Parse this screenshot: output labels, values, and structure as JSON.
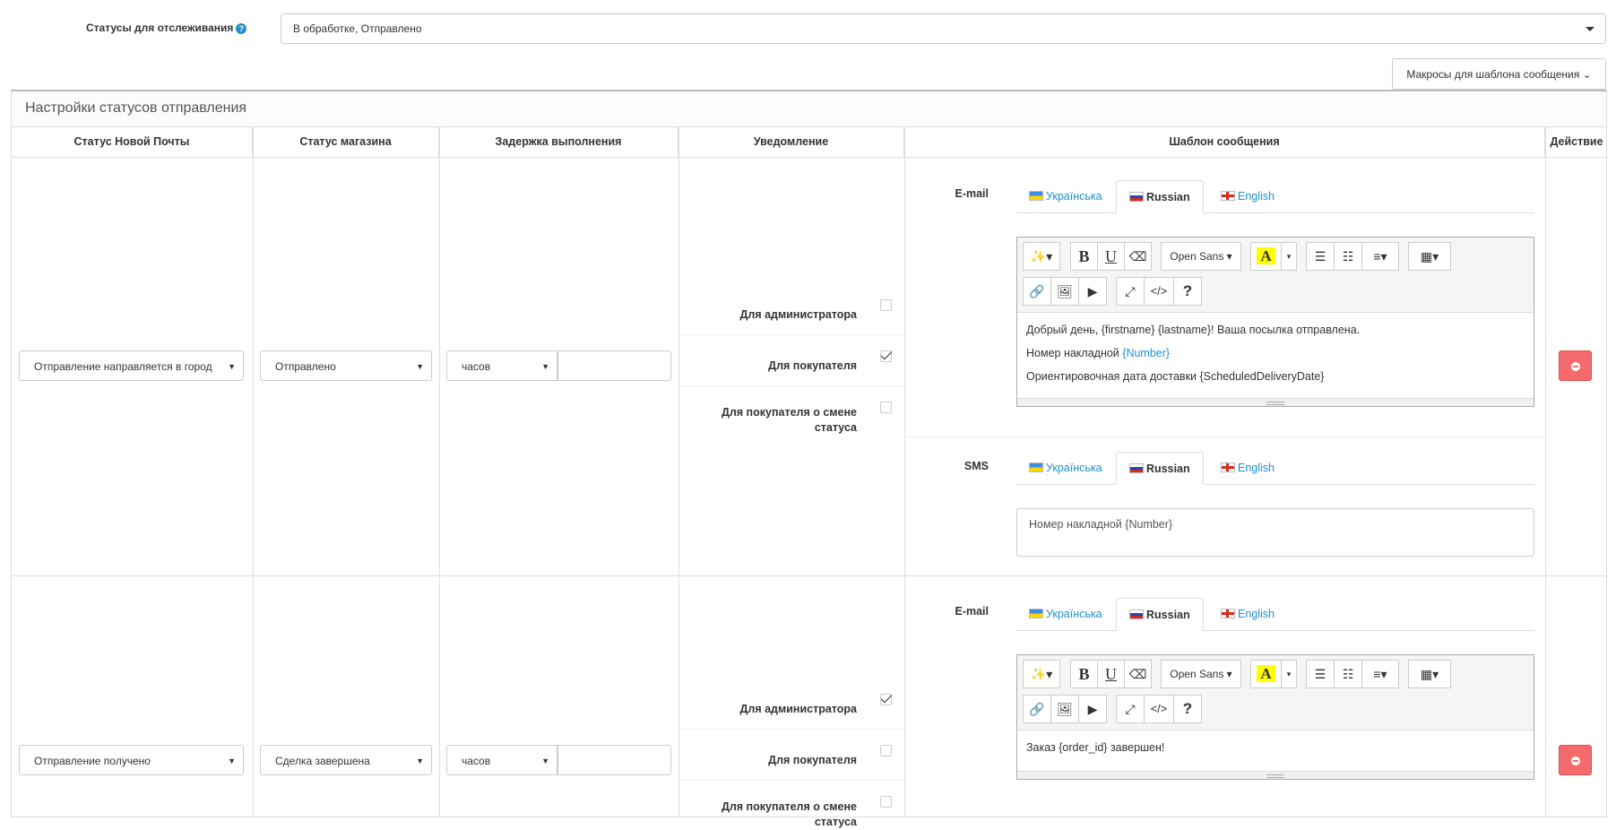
{
  "tracking": {
    "label": "Статусы для отслеживания",
    "value": "В обработке, Отправлено"
  },
  "macros_button": "Макросы для шаблона сообщения",
  "panel_title": "Настройки статусов отправления",
  "columns": [
    "Статус Новой Почты",
    "Статус магазина",
    "Задержка выполнения",
    "Уведомление",
    "Шаблон сообщения",
    "Действие"
  ],
  "languages": [
    "Українська",
    "Russian",
    "English"
  ],
  "channels": {
    "email": "E-mail",
    "sms": "SMS"
  },
  "toolbar": {
    "font": "Open Sans",
    "highlight": "A",
    "bold": "B",
    "underline": "U",
    "code": "</>",
    "help": "?"
  },
  "notifications": {
    "admin": "Для администратора",
    "buyer": "Для покупателя",
    "buyer_status": "Для покупателя о смене статуса"
  },
  "rows": [
    {
      "np_status": "Отправление направляется в город",
      "shop_status": "Отправлено",
      "delay_unit": "часов",
      "delay_value": "",
      "notify": {
        "admin": false,
        "buyer": true,
        "buyer_status": false
      },
      "email": {
        "line1": "Добрый день, {firstname} {lastname}! Ваша посылка отправлена.",
        "line2_text": "Номер накладной ",
        "line2_macro": "{Number}",
        "line3": "Ориентировочная дата доставки {ScheduledDeliveryDate}"
      },
      "sms": "Номер накладной {Number}"
    },
    {
      "np_status": "Отправление получено",
      "shop_status": "Сделка завершена",
      "delay_unit": "часов",
      "delay_value": "",
      "notify": {
        "admin": true,
        "buyer": false,
        "buyer_status": false
      },
      "email": {
        "line1": "Заказ {order_id} завершен!"
      }
    }
  ]
}
